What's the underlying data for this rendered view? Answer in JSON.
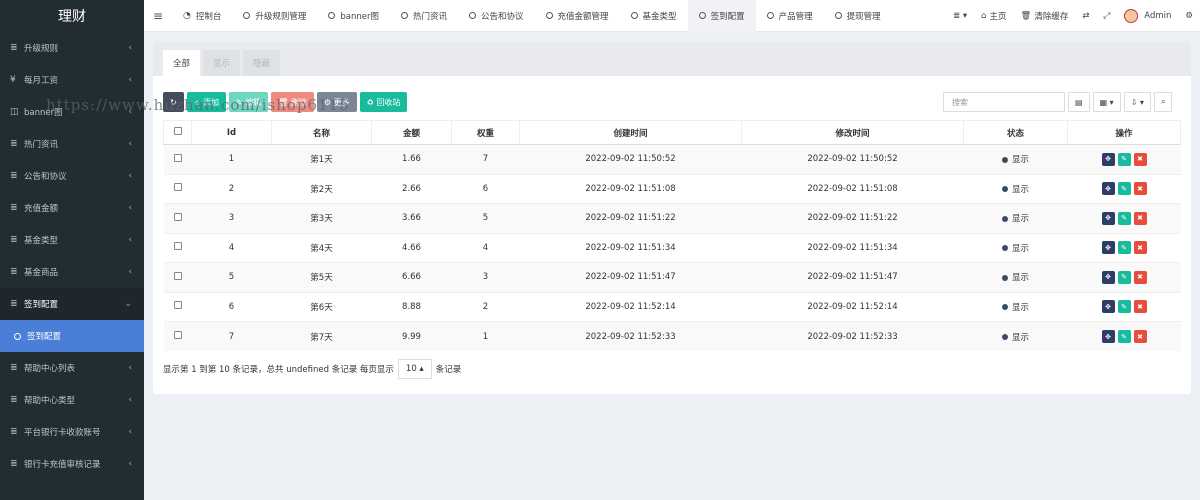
{
  "brand": "理财",
  "sidebar": {
    "items": [
      {
        "icon": "≣",
        "label": "升级规则",
        "chevron": "‹"
      },
      {
        "icon": "¥",
        "label": "每月工资",
        "chevron": "‹"
      },
      {
        "icon": "◫",
        "label": "banner图",
        "chevron": "‹"
      },
      {
        "icon": "≣",
        "label": "热门资讯",
        "chevron": "‹"
      },
      {
        "icon": "≣",
        "label": "公告和协议",
        "chevron": "‹"
      },
      {
        "icon": "≣",
        "label": "充值金额",
        "chevron": "‹"
      },
      {
        "icon": "≣",
        "label": "基金类型",
        "chevron": "‹"
      },
      {
        "icon": "≣",
        "label": "基金商品",
        "chevron": "‹"
      },
      {
        "icon": "≣",
        "label": "签到配置",
        "chevron": "⌄"
      }
    ],
    "sub_active": "签到配置",
    "items_after": [
      {
        "icon": "≣",
        "label": "帮助中心列表",
        "chevron": "‹"
      },
      {
        "icon": "≣",
        "label": "帮助中心类型",
        "chevron": "‹"
      },
      {
        "icon": "≣",
        "label": "平台银行卡收款账号",
        "chevron": "‹"
      },
      {
        "icon": "≣",
        "label": "银行卡充值审核记录",
        "chevron": "‹"
      }
    ]
  },
  "topnav": {
    "tabs": [
      "控制台",
      "升级规则管理",
      "banner图",
      "热门资讯",
      "公告和协议",
      "充值金额管理",
      "基金类型",
      "签到配置",
      "产品管理",
      "提现管理"
    ],
    "home": "主页",
    "clear_cache": "清除缓存",
    "user": "Admin"
  },
  "panel_tabs": [
    "全部",
    "显示",
    "隐藏"
  ],
  "toolbar": {
    "refresh": "↻",
    "add": "+ 添加",
    "edit": "✎ 编辑",
    "delete": "🗑 删除",
    "more": "⚙ 更多",
    "recycle": "♻ 回收站"
  },
  "search_placeholder": "搜索",
  "table": {
    "headers": [
      "Id",
      "名称",
      "金额",
      "权重",
      "创建时间",
      "修改时间",
      "状态",
      "操作"
    ],
    "rows": [
      {
        "id": "1",
        "name": "第1天",
        "amount": "1.66",
        "weight": "7",
        "created": "2022-09-02 11:50:52",
        "updated": "2022-09-02 11:50:52",
        "status": "显示"
      },
      {
        "id": "2",
        "name": "第2天",
        "amount": "2.66",
        "weight": "6",
        "created": "2022-09-02 11:51:08",
        "updated": "2022-09-02 11:51:08",
        "status": "显示"
      },
      {
        "id": "3",
        "name": "第3天",
        "amount": "3.66",
        "weight": "5",
        "created": "2022-09-02 11:51:22",
        "updated": "2022-09-02 11:51:22",
        "status": "显示"
      },
      {
        "id": "4",
        "name": "第4天",
        "amount": "4.66",
        "weight": "4",
        "created": "2022-09-02 11:51:34",
        "updated": "2022-09-02 11:51:34",
        "status": "显示"
      },
      {
        "id": "5",
        "name": "第5天",
        "amount": "6.66",
        "weight": "3",
        "created": "2022-09-02 11:51:47",
        "updated": "2022-09-02 11:51:47",
        "status": "显示"
      },
      {
        "id": "6",
        "name": "第6天",
        "amount": "8.88",
        "weight": "2",
        "created": "2022-09-02 11:52:14",
        "updated": "2022-09-02 11:52:14",
        "status": "显示"
      },
      {
        "id": "7",
        "name": "第7天",
        "amount": "9.99",
        "weight": "1",
        "created": "2022-09-02 11:52:33",
        "updated": "2022-09-02 11:52:33",
        "status": "显示"
      }
    ]
  },
  "footer": {
    "summary": "显示第 1 到第 10 条记录，总共 undefined 条记录 每页显示",
    "page_size": "10 ▴",
    "suffix": "条记录"
  },
  "watermark": "https://www.huzhan.com/ishop6115",
  "colors": {
    "sidebar_bg": "#222d32",
    "active_sub": "#4b7fd7",
    "green": "#18bc9c",
    "red": "#e74c3c"
  }
}
